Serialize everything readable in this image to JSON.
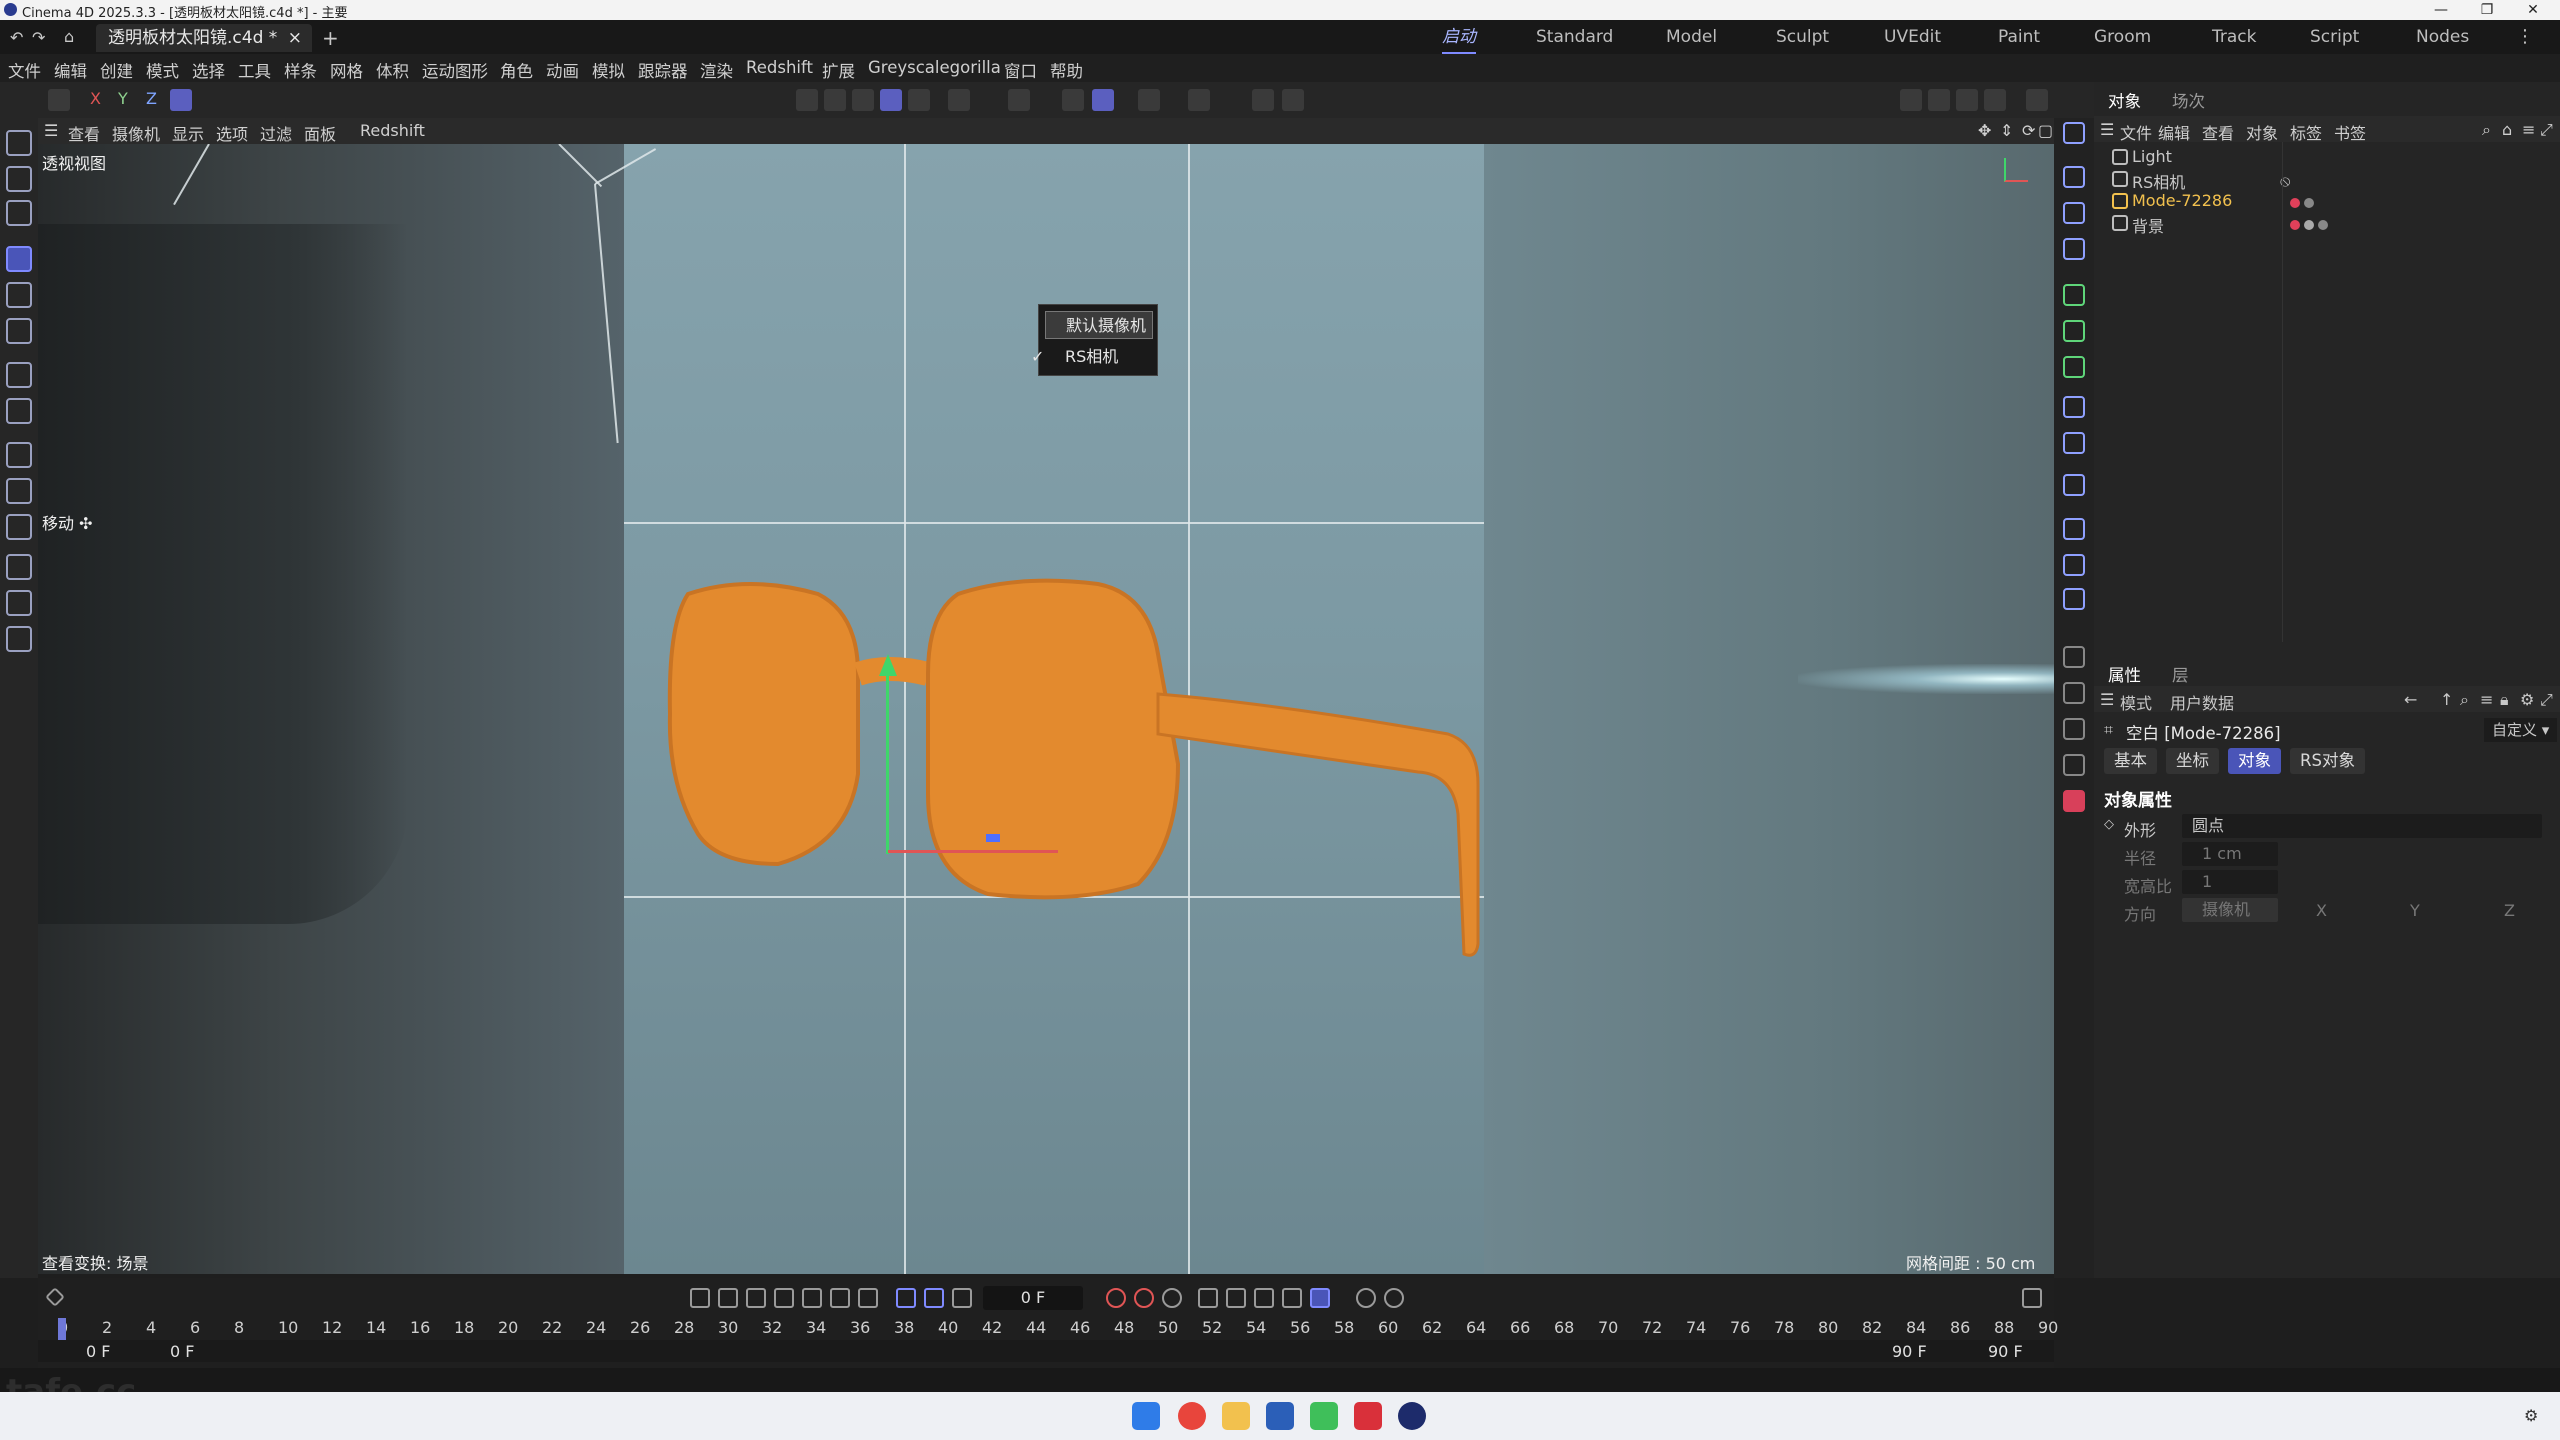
{
  "window": {
    "title": "Cinema 4D 2025.3.3 - [透明板材太阳镜.c4d *] - 主要",
    "doc_tab": "透明板材太阳镜.c4d *"
  },
  "layouts": [
    "启动",
    "Standard",
    "Model",
    "Sculpt",
    "UVEdit",
    "Paint",
    "Groom",
    "Track",
    "Script",
    "Nodes"
  ],
  "active_layout": "启动",
  "menu": [
    "文件",
    "编辑",
    "创建",
    "模式",
    "选择",
    "工具",
    "样条",
    "网格",
    "体积",
    "运动图形",
    "角色",
    "动画",
    "模拟",
    "跟踪器",
    "渲染",
    "Redshift",
    "扩展",
    "Greyscalegorilla",
    "窗口",
    "帮助"
  ],
  "axis_toggles": [
    "X",
    "Y",
    "Z"
  ],
  "viewport_menu": [
    "查看",
    "摄像机",
    "显示",
    "选项",
    "过滤",
    "面板",
    "Redshift"
  ],
  "viewport": {
    "title": "透视视图",
    "tool_label": "移动 ✣",
    "status": "查看变换: 场景",
    "grid_spacing": "网格间距 : 50 cm"
  },
  "camera_menu": {
    "items": [
      "默认摄像机",
      "RS相机"
    ],
    "checked": "RS相机"
  },
  "object_manager": {
    "tabs": [
      "对象",
      "场次"
    ],
    "menu": [
      "文件",
      "编辑",
      "查看",
      "对象",
      "标签",
      "书签"
    ],
    "objects": [
      {
        "name": "Light"
      },
      {
        "name": "RS相机"
      },
      {
        "name": "Mode-72286",
        "color": "#f2c14e"
      },
      {
        "name": "背景"
      }
    ]
  },
  "attributes": {
    "tabs": [
      "属性",
      "层"
    ],
    "menu": [
      "模式",
      "用户数据"
    ],
    "object_title": "空白 [Mode-72286]",
    "preset": "自定义",
    "buttons": [
      "基本",
      "坐标",
      "对象",
      "RS对象"
    ],
    "active_button": "对象",
    "section": "对象属性",
    "props": [
      {
        "label": "外形",
        "value": "圆点"
      },
      {
        "label": "半径",
        "value": "1 cm"
      },
      {
        "label": "宽高比",
        "value": "1"
      },
      {
        "label": "方向",
        "value": "摄像机"
      }
    ],
    "axes": [
      "X",
      "Y",
      "Z"
    ]
  },
  "timeline": {
    "current_frame": "0 F",
    "ticks": [
      "0",
      "2",
      "4",
      "6",
      "8",
      "10",
      "12",
      "14",
      "16",
      "18",
      "20",
      "22",
      "24",
      "26",
      "28",
      "30",
      "32",
      "34",
      "36",
      "38",
      "40",
      "42",
      "44",
      "46",
      "48",
      "50",
      "52",
      "54",
      "56",
      "58",
      "60",
      "62",
      "64",
      "66",
      "68",
      "70",
      "72",
      "74",
      "76",
      "78",
      "80",
      "82",
      "84",
      "86",
      "88",
      "90"
    ],
    "start": "0 F",
    "start2": "0 F",
    "end": "90 F",
    "end2": "90 F"
  },
  "watermark": "tafe.cc",
  "colors": {
    "accent": "#5b5fbf",
    "selection": "#e38a2e",
    "highlight_text": "#f2c14e"
  }
}
